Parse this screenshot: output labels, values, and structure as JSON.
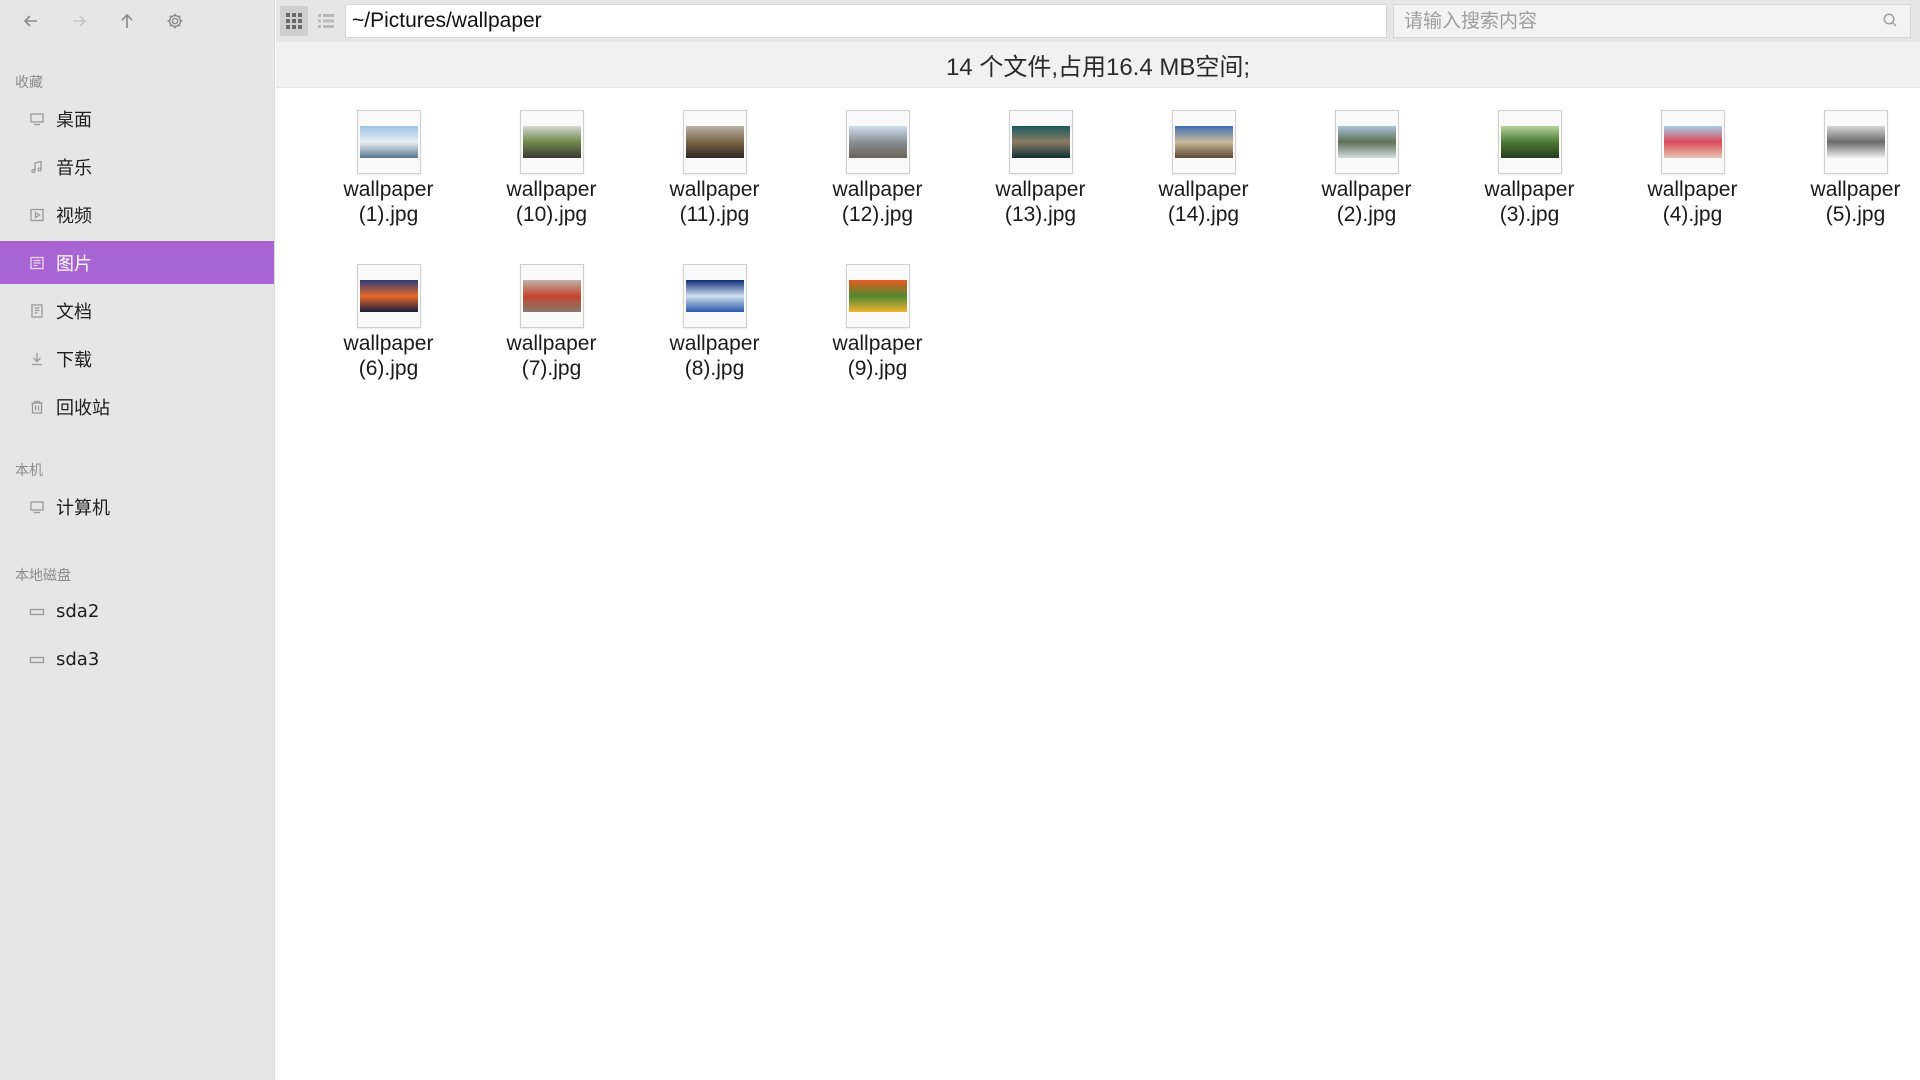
{
  "nav": {
    "icons": [
      "back-arrow-icon",
      "forward-arrow-icon",
      "up-arrow-icon",
      "gear-icon"
    ]
  },
  "sidebar": {
    "favorites_label": "收藏",
    "favorites": [
      {
        "label": "桌面",
        "icon": "monitor-icon"
      },
      {
        "label": "音乐",
        "icon": "music-icon"
      },
      {
        "label": "视频",
        "icon": "video-icon"
      },
      {
        "label": "图片",
        "icon": "picture-icon",
        "active": true
      },
      {
        "label": "文档",
        "icon": "document-icon"
      },
      {
        "label": "下载",
        "icon": "download-icon"
      },
      {
        "label": "回收站",
        "icon": "trash-icon"
      }
    ],
    "local_label": "本机",
    "local": [
      {
        "label": "计算机",
        "icon": "computer-icon"
      }
    ],
    "disk_label": "本地磁盘",
    "disks": [
      {
        "label": "sda2",
        "icon": "drive-icon"
      },
      {
        "label": "sda3",
        "icon": "drive-icon"
      }
    ],
    "accent_color": "#a864d2"
  },
  "toolbar": {
    "path": "~/Pictures/wallpaper",
    "search_placeholder": "请输入搜索内容",
    "view_modes": [
      "grid-view-icon",
      "list-view-icon"
    ],
    "active_view": "grid"
  },
  "status": {
    "text": "14 个文件,占用16.4 MB空间;"
  },
  "files": [
    {
      "line1": "wallpaper",
      "line2": "(1).jpg",
      "colors": [
        "#9fc4e3",
        "#e9eef3",
        "#5a7690"
      ]
    },
    {
      "line1": "wallpaper",
      "line2": "(10).jpg",
      "colors": [
        "#d9d6d3",
        "#6f8a4a",
        "#3c3a36"
      ]
    },
    {
      "line1": "wallpaper",
      "line2": "(11).jpg",
      "colors": [
        "#b9b3aa",
        "#7a6546",
        "#2b2822"
      ]
    },
    {
      "line1": "wallpaper",
      "line2": "(12).jpg",
      "colors": [
        "#cfe0ee",
        "#8a8f95",
        "#6a6157"
      ]
    },
    {
      "line1": "wallpaper",
      "line2": "(13).jpg",
      "colors": [
        "#1c5a61",
        "#8b7b64",
        "#0f2f34"
      ]
    },
    {
      "line1": "wallpaper",
      "line2": "(14).jpg",
      "colors": [
        "#3e6fb3",
        "#c9b89a",
        "#5b4a33"
      ]
    },
    {
      "line1": "wallpaper",
      "line2": "(2).jpg",
      "colors": [
        "#a9c2d9",
        "#5f7057",
        "#d5dbe0"
      ]
    },
    {
      "line1": "wallpaper",
      "line2": "(3).jpg",
      "colors": [
        "#b7d39a",
        "#4c7a34",
        "#253c1a"
      ]
    },
    {
      "line1": "wallpaper",
      "line2": "(4).jpg",
      "colors": [
        "#a8cfe9",
        "#d94a57",
        "#e7c8b4"
      ]
    },
    {
      "line1": "wallpaper",
      "line2": "(5).jpg",
      "colors": [
        "#d7d7d7",
        "#6a6a6a",
        "#f2f2f2"
      ]
    },
    {
      "line1": "wallpaper",
      "line2": "(6).jpg",
      "colors": [
        "#2a3a7a",
        "#e86a2a",
        "#1a1d3a"
      ]
    },
    {
      "line1": "wallpaper",
      "line2": "(7).jpg",
      "colors": [
        "#bdb3a7",
        "#c8442f",
        "#857a6c"
      ]
    },
    {
      "line1": "wallpaper",
      "line2": "(8).jpg",
      "colors": [
        "#0f2f7a",
        "#cfe0f0",
        "#2a58a8"
      ]
    },
    {
      "line1": "wallpaper",
      "line2": "(9).jpg",
      "colors": [
        "#e85b1e",
        "#4f8a2e",
        "#f2b233"
      ]
    }
  ]
}
